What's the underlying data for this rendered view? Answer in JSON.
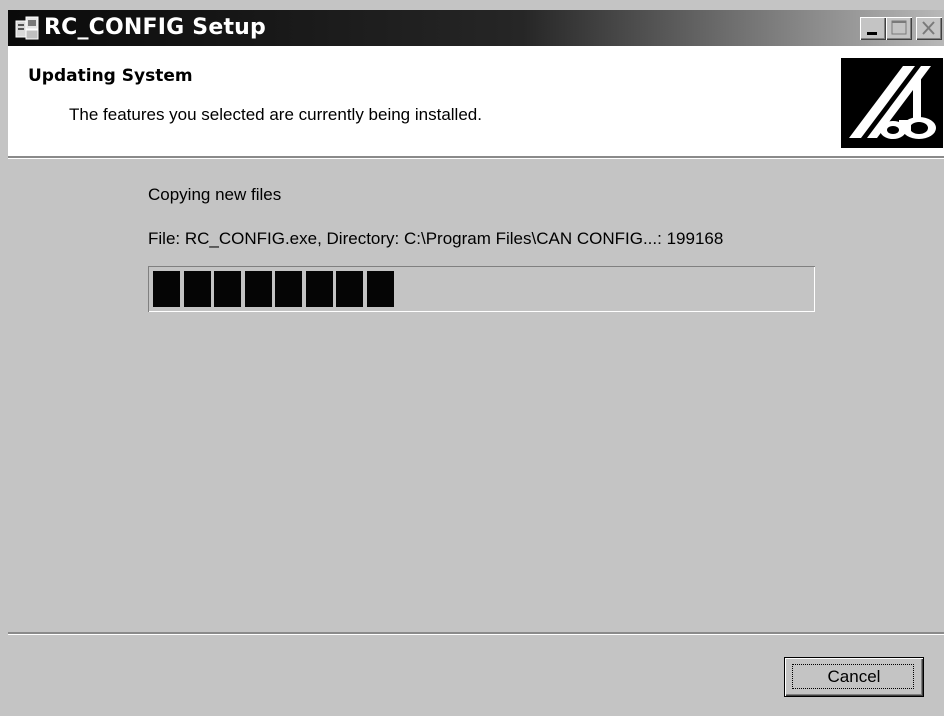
{
  "window": {
    "title": "RC_CONFIG Setup",
    "icon": "setup-icon",
    "controls": {
      "minimize_icon": "minimize-icon",
      "maximize_icon": "maximize-icon",
      "close_icon": "close-icon"
    }
  },
  "header": {
    "title": "Updating System",
    "description": "The features you selected are currently being installed.",
    "logo": "installer-logo"
  },
  "body": {
    "status": "Copying new files",
    "file_info": "File: RC_CONFIG.exe,  Directory: C:\\Program Files\\CAN CONFIG...: 199168",
    "progress": {
      "blocks_filled": 8,
      "percent": 36
    }
  },
  "footer": {
    "cancel_label": "Cancel"
  },
  "colors": {
    "face": "#c4c4c4",
    "titlebar_start": "#0a0a0a",
    "titlebar_end": "#b8b8b8",
    "progress_block": "#050505"
  }
}
